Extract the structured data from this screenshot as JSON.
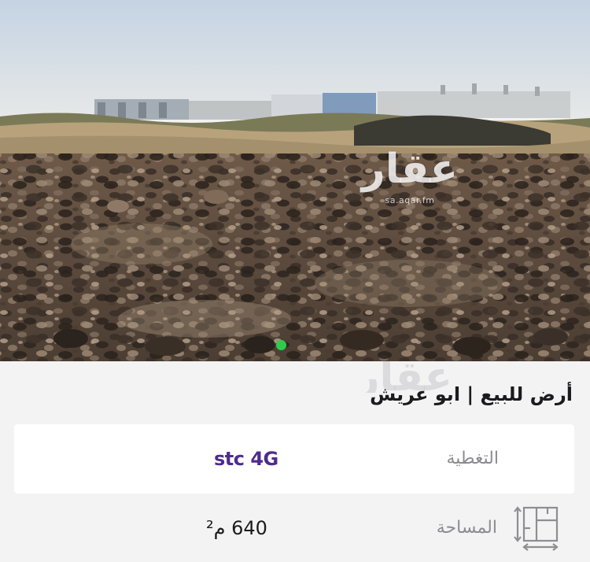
{
  "photo": {
    "watermark_word": "عقار",
    "watermark_domain": "sa.aqar.fm"
  },
  "listing": {
    "title": "أرض للبيع | ابو عريش"
  },
  "coverage": {
    "label": "التغطية",
    "value": "stc 4G",
    "brand_color": "#4e2c8e"
  },
  "area": {
    "label": "المساحة",
    "value": "640 م²",
    "icon": "area-ruler-icon"
  },
  "colors": {
    "status_dot": "#2ecc4a",
    "sheet_background": "#f3f3f4",
    "label_gray": "#8c8c90"
  }
}
